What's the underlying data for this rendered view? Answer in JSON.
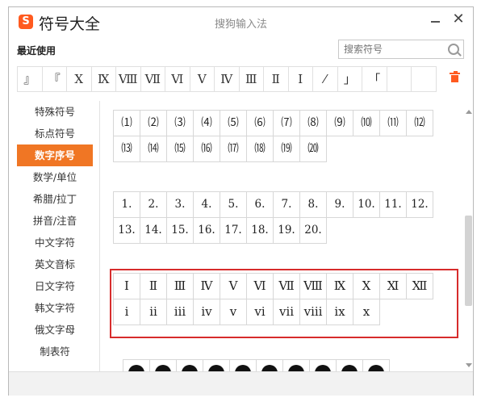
{
  "window": {
    "app_title": "符号大全",
    "subtitle": "搜狗输入法",
    "logo_letter": "S",
    "close_glyph": "✕"
  },
  "recent": {
    "label": "最近使用",
    "items": [
      "』",
      "『",
      "Ⅹ",
      "Ⅸ",
      "Ⅷ",
      "Ⅶ",
      "Ⅵ",
      "Ⅴ",
      "Ⅳ",
      "Ⅲ",
      "Ⅱ",
      "Ⅰ",
      "⁄",
      "」",
      "「",
      "",
      ""
    ]
  },
  "search": {
    "placeholder": "搜索符号"
  },
  "sidebar": {
    "items": [
      "特殊符号",
      "标点符号",
      "数字序号",
      "数学/单位",
      "希腊/拉丁",
      "拼音/注音",
      "中文字符",
      "英文音标",
      "日文字符",
      "韩文字符",
      "俄文字母",
      "制表符"
    ],
    "active": "数字序号"
  },
  "content": {
    "parenthesized": [
      "⑴",
      "⑵",
      "⑶",
      "⑷",
      "⑸",
      "⑹",
      "⑺",
      "⑻",
      "⑼",
      "⑽",
      "⑾",
      "⑿",
      "⒀",
      "⒁",
      "⒂",
      "⒃",
      "⒄",
      "⒅",
      "⒆",
      "⒇"
    ],
    "dotted": [
      "1.",
      "2.",
      "3.",
      "4.",
      "5.",
      "6.",
      "7.",
      "8.",
      "9.",
      "10.",
      "11.",
      "12.",
      "13.",
      "14.",
      "15.",
      "16.",
      "17.",
      "18.",
      "19.",
      "20."
    ],
    "roman_upper": [
      "Ⅰ",
      "Ⅱ",
      "Ⅲ",
      "Ⅳ",
      "Ⅴ",
      "Ⅵ",
      "Ⅶ",
      "Ⅷ",
      "Ⅸ",
      "Ⅹ",
      "Ⅺ",
      "Ⅻ"
    ],
    "roman_lower": [
      "ⅰ",
      "ⅱ",
      "ⅲ",
      "ⅳ",
      "ⅴ",
      "ⅵ",
      "ⅶ",
      "ⅷ",
      "ⅸ",
      "ⅹ"
    ],
    "partial_row_count": 10
  },
  "colors": {
    "accent": "#f07624",
    "highlight": "#d72c2c"
  }
}
